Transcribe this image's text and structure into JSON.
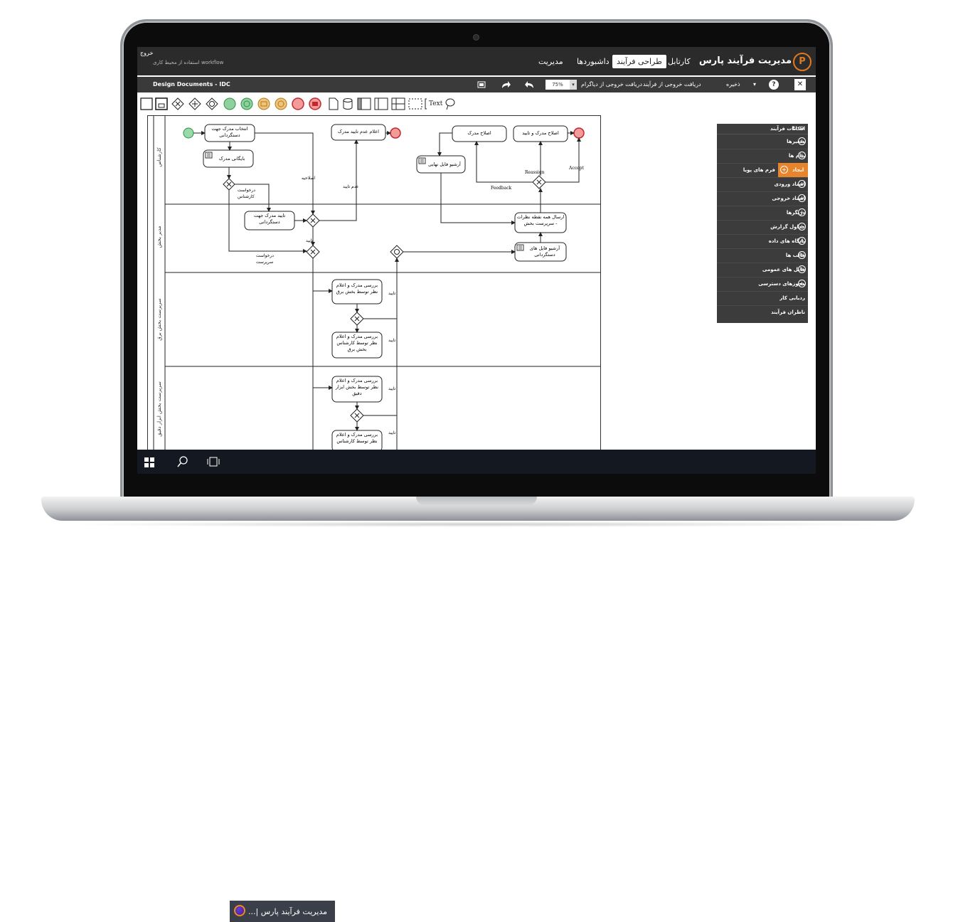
{
  "header": {
    "app_title": "مدیریت فرآیند پارس",
    "logo_letter": "P",
    "nav": [
      "کارتابل",
      "طراحی فرآیند",
      "داشبوردها",
      "مدیریت"
    ],
    "logout": "خروج",
    "workspace_text": "استفاده از محیط کاری workflow"
  },
  "toolbar": {
    "doc_title": "Design Documents - IDC",
    "close": "✕",
    "help": "?",
    "save": "ذخیره",
    "export_process": "دریافت خروجی از فرآیند",
    "export_diagram": "دریافت خروجی از دیاگرام",
    "zoom": "75%"
  },
  "palette": {
    "text_tool": "Text"
  },
  "lanes": [
    "کارشناس",
    "مدیر بخش",
    "سرپرست بخش برق",
    "سرپرست بخش ابزار دقیق"
  ],
  "tasks": {
    "t1": "انتخاب مدرک جهت دستگردانی",
    "t2": "بایگانی مدرک",
    "t3": "اعلام عدم تایید مدرک",
    "t4": "اصلاح مدرک",
    "t5": "اصلاح مدرک و تایید",
    "t6": "آرشیو فایل نهایی",
    "t7": "تایید مدرک جهت دستگردانی",
    "t8": "ارسال همه نقطه نظرات - سرپرست بخش",
    "t9": "آرشیو فایل های دستگردانی",
    "t10": "بررسی مدرک و اعلام نظر توسط بخش برق",
    "t11": "بررسی مدرک و اعلام نظر توسط کارشناس بخش برق",
    "t12": "بررسی مدرک و اعلام نظر توسط بخش ابزار دقیق",
    "t13": "بررسی مدرک و اعلام نظر توسط کارشناس"
  },
  "flow_labels": {
    "f1": "اصلاحیه",
    "f2": "عدم تایید",
    "f3": "درخواست کارشناس",
    "f4": "درخواست سرپرست",
    "f5": "تایید",
    "f6": "Reassign",
    "f7": "Feedback",
    "f8": "Accept"
  },
  "panel": {
    "title": "امکانات فرآیند",
    "items": [
      "متغیرها",
      "پیام ها",
      "فرم های پویا",
      "اسناد ورودی",
      "اسناد خروجی",
      "دریگرها",
      "جداول گزارش",
      "پایگاه های داده",
      "قالب ها",
      "فایل های عمومی",
      "مجوزهای دسترسی",
      "ردیابی کار",
      "ناظران فرآیند"
    ],
    "create_label": "ایجاد"
  },
  "taskbar": {
    "app_label": "...| مدیریت فرآیند پارس"
  }
}
